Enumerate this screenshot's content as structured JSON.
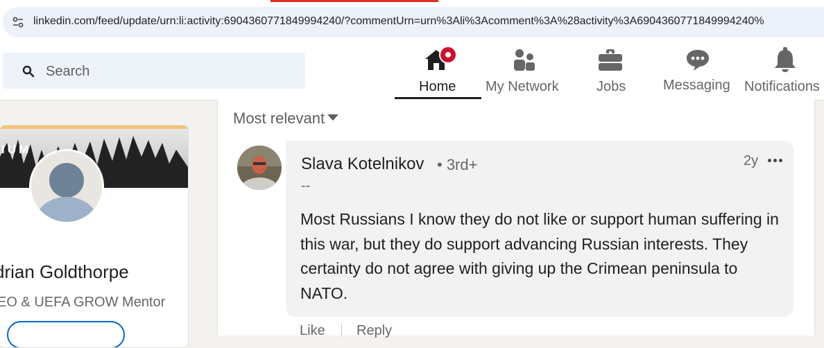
{
  "browser": {
    "url": "linkedin.com/feed/update/urn:li:activity:6904360771849994240/?commentUrn=urn%3Ali%3Acomment%3A%28activity%3A6904360771849994240%"
  },
  "header": {
    "search_placeholder": "Search",
    "nav": [
      {
        "label": "Home",
        "icon": "home-icon",
        "active": true
      },
      {
        "label": "My Network",
        "icon": "network-icon"
      },
      {
        "label": "Jobs",
        "icon": "briefcase-icon"
      },
      {
        "label": "Messaging",
        "icon": "message-icon"
      },
      {
        "label": "Notifications",
        "icon": "bell-icon"
      }
    ]
  },
  "profile": {
    "cover_text": "IUM",
    "name": "drian Goldthorpe",
    "headline": "EO & UEFA GROW Mentor"
  },
  "comments": {
    "sort_label": "Most relevant",
    "items": [
      {
        "author": "Slava Kotelnikov",
        "degree": "• 3rd+",
        "subtitle": "--",
        "time": "2y",
        "text": "Most Russians I know they do not like or support human suffering in this war, but they do support advancing Russian interests. They certainty do not agree with giving up the Crimean peninsula to NATO.",
        "actions": [
          "Like",
          "Reply"
        ]
      }
    ]
  },
  "colors": {
    "accent": "#0a66c2",
    "badge": "#cb112d",
    "page_bg": "#f4f2ee"
  }
}
